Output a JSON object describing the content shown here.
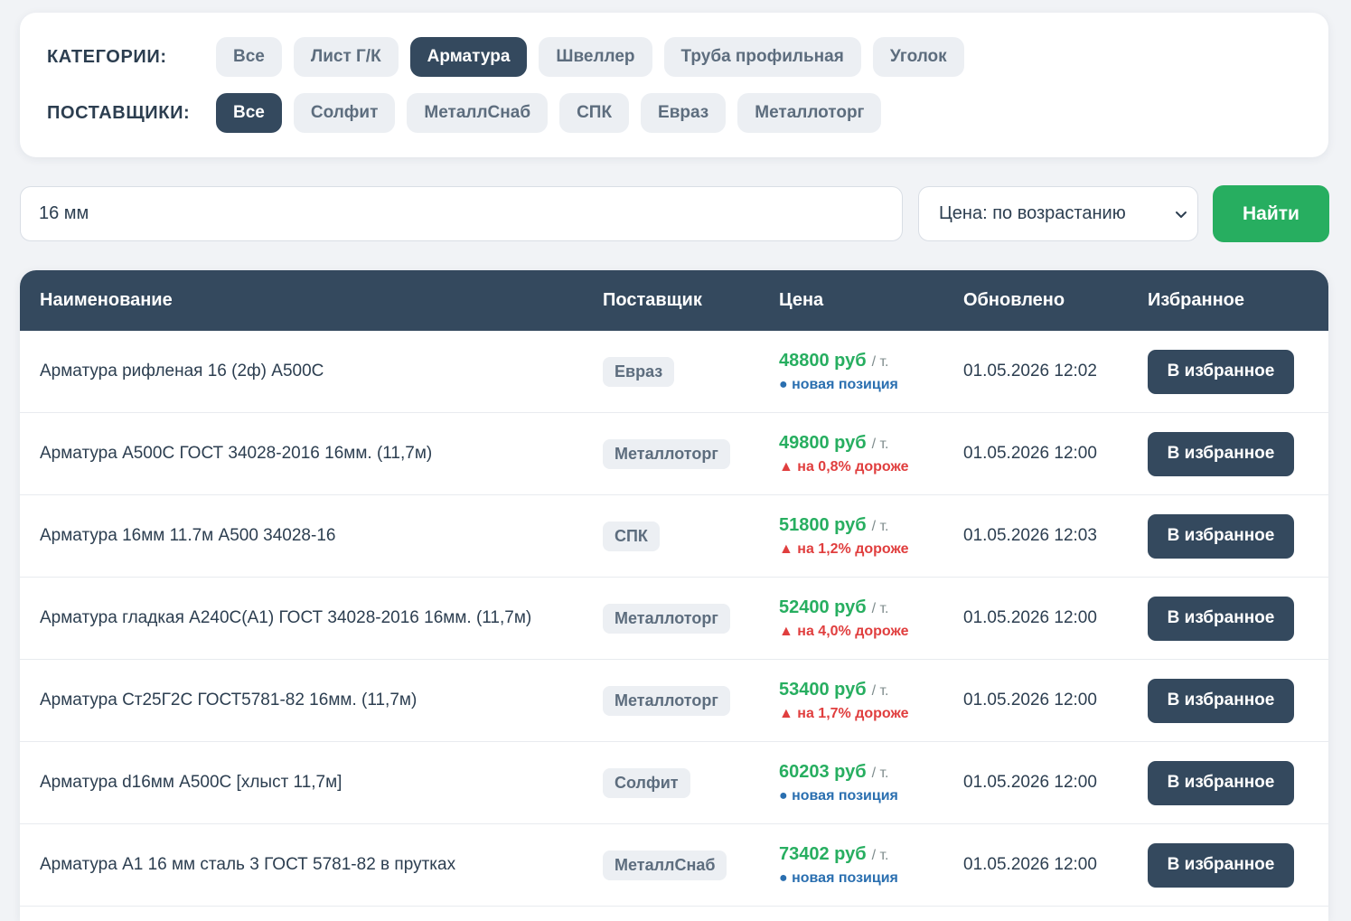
{
  "filters": {
    "categories_label": "КАТЕГОРИИ:",
    "suppliers_label": "ПОСТАВЩИКИ:",
    "categories": [
      "Все",
      "Лист Г/К",
      "Арматура",
      "Швеллер",
      "Труба профильная",
      "Уголок"
    ],
    "categories_active": "Арматура",
    "suppliers": [
      "Все",
      "Солфит",
      "МеталлСнаб",
      "СПК",
      "Евраз",
      "Металлоторг"
    ],
    "suppliers_active": "Все"
  },
  "search": {
    "value": "16 мм"
  },
  "sort": {
    "selected": "Цена: по возрастанию"
  },
  "find_button": "Найти",
  "table": {
    "headers": {
      "name": "Наименование",
      "supplier": "Поставщик",
      "price": "Цена",
      "updated": "Обновлено",
      "favorite": "Избранное"
    },
    "rows": [
      {
        "name": "Арматура рифленая 16 (2ф) А500С",
        "supplier": "Евраз",
        "price": "48800 руб",
        "unit": "/ т.",
        "delta": "● новая позиция",
        "delta_type": "new",
        "updated": "01.05.2026 12:02",
        "fav": "В избранное"
      },
      {
        "name": "Арматура А500С ГОСТ 34028-2016 16мм. (11,7м)",
        "supplier": "Металлоторг",
        "price": "49800 руб",
        "unit": "/ т.",
        "delta": "▲ на 0,8% дороже",
        "delta_type": "up",
        "updated": "01.05.2026 12:00",
        "fav": "В избранное"
      },
      {
        "name": "Арматура 16мм 11.7м А500 34028-16",
        "supplier": "СПК",
        "price": "51800 руб",
        "unit": "/ т.",
        "delta": "▲ на 1,2% дороже",
        "delta_type": "up",
        "updated": "01.05.2026 12:03",
        "fav": "В избранное"
      },
      {
        "name": "Арматура гладкая А240С(А1) ГОСТ 34028-2016 16мм. (11,7м)",
        "supplier": "Металлоторг",
        "price": "52400 руб",
        "unit": "/ т.",
        "delta": "▲ на 4,0% дороже",
        "delta_type": "up",
        "updated": "01.05.2026 12:00",
        "fav": "В избранное"
      },
      {
        "name": "Арматура Ст25Г2С ГОСТ5781-82 16мм. (11,7м)",
        "supplier": "Металлоторг",
        "price": "53400 руб",
        "unit": "/ т.",
        "delta": "▲ на 1,7% дороже",
        "delta_type": "up",
        "updated": "01.05.2026 12:00",
        "fav": "В избранное"
      },
      {
        "name": "Арматура d16мм А500С [хлыст 11,7м]",
        "supplier": "Солфит",
        "price": "60203 руб",
        "unit": "/ т.",
        "delta": "● новая позиция",
        "delta_type": "new",
        "updated": "01.05.2026 12:00",
        "fav": "В избранное"
      },
      {
        "name": "Арматура А1 16 мм сталь 3 ГОСТ 5781-82 в прутках",
        "supplier": "МеталлСнаб",
        "price": "73402 руб",
        "unit": "/ т.",
        "delta": "● новая позиция",
        "delta_type": "new",
        "updated": "01.05.2026 12:00",
        "fav": "В избранное"
      }
    ]
  },
  "colors": {
    "primary_dark": "#34495e",
    "accent_green": "#27ae60",
    "up_red": "#e03e3e",
    "new_blue": "#2a6fb0"
  }
}
